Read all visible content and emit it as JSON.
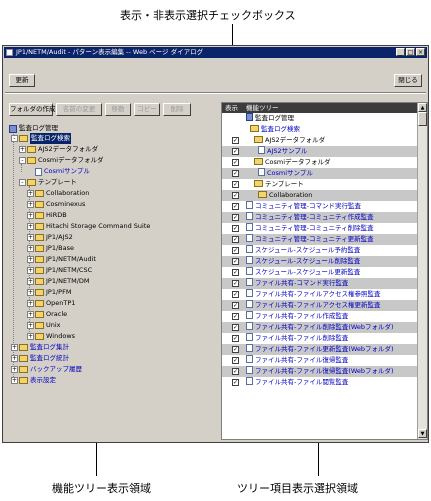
{
  "callouts": {
    "checkbox": "表示・非表示選択チェックボックス",
    "left_area": "機能ツリー表示領域",
    "right_area": "ツリー項目表示選択領域"
  },
  "window": {
    "title": "JP1/NETM/Audit - パターン表示編集 -- Web ページ ダイアログ",
    "min": "_",
    "max": "□",
    "close": "×"
  },
  "toolbar": {
    "update": "更新",
    "close": "閉じる"
  },
  "left_buttons": {
    "create_folder": "フォルダの作成",
    "rename": "名前の変更",
    "move": "移動",
    "copy": "コピー",
    "delete": "削除"
  },
  "tree": [
    {
      "label": "監査ログ管理"
    },
    {
      "label": "監査ログ検索"
    },
    {
      "label": "AJS2データフォルダ"
    },
    {
      "label": "Cosmiデータフォルダ"
    },
    {
      "label": "Cosmiサンプル"
    },
    {
      "label": "テンプレート"
    },
    {
      "label": "Collaboration"
    },
    {
      "label": "Cosminexus"
    },
    {
      "label": "HiRDB"
    },
    {
      "label": "Hitachi Storage Command Suite"
    },
    {
      "label": "JP1/AJS2"
    },
    {
      "label": "JP1/Base"
    },
    {
      "label": "JP1/NETM/Audit"
    },
    {
      "label": "JP1/NETM/CSC"
    },
    {
      "label": "JP1/NETM/DM"
    },
    {
      "label": "JP1/PFM"
    },
    {
      "label": "OpenTP1"
    },
    {
      "label": "Oracle"
    },
    {
      "label": "Unix"
    },
    {
      "label": "Windows"
    },
    {
      "label": "監査ログ集計"
    },
    {
      "label": "監査ログ統計"
    },
    {
      "label": "バックアップ履歴"
    },
    {
      "label": "表示設定"
    }
  ],
  "right_header": {
    "display": "表示",
    "function_tree": "機能ツリー"
  },
  "right_rows": [
    {
      "label": "監査ログ管理",
      "checked": false
    },
    {
      "label": "監査ログ検索",
      "checked": false
    },
    {
      "label": "AJS2データフォルダ",
      "checked": true
    },
    {
      "label": "AJS2サンプル",
      "checked": true
    },
    {
      "label": "Cosmiデータフォルダ",
      "checked": true
    },
    {
      "label": "Cosmiサンプル",
      "checked": true
    },
    {
      "label": "テンプレート",
      "checked": true
    },
    {
      "label": "Collaboration",
      "checked": true
    },
    {
      "label": "コミュニティ管理-コマンド実行監査",
      "checked": true
    },
    {
      "label": "コミュニティ管理-コミュニティ作成監査",
      "checked": true
    },
    {
      "label": "コミュニティ管理-コミュニティ削除監査",
      "checked": true
    },
    {
      "label": "コミュニティ管理-コミュニティ更新監査",
      "checked": true
    },
    {
      "label": "スケジュール-スケジュール予約監査",
      "checked": true
    },
    {
      "label": "スケジュール-スケジュール削除監査",
      "checked": true
    },
    {
      "label": "スケジュール-スケジュール更新監査",
      "checked": true
    },
    {
      "label": "ファイル共有-コマンド実行監査",
      "checked": true
    },
    {
      "label": "ファイル共有-ファイルアクセス権参照監査",
      "checked": true
    },
    {
      "label": "ファイル共有-ファイルアクセス権更新監査",
      "checked": true
    },
    {
      "label": "ファイル共有-ファイル作成監査",
      "checked": true
    },
    {
      "label": "ファイル共有-ファイル削除監査(Webフォルダ)",
      "checked": true
    },
    {
      "label": "ファイル共有-ファイル削除監査",
      "checked": true
    },
    {
      "label": "ファイル共有-ファイル更新監査(Webフォルダ)",
      "checked": true
    },
    {
      "label": "ファイル共有-ファイル復帰監査",
      "checked": true
    },
    {
      "label": "ファイル共有-ファイル復帰監査(Webフォルダ)",
      "checked": true
    },
    {
      "label": "ファイル共有-ファイル閲覧監査",
      "checked": true
    }
  ],
  "icons": {
    "folder": "folder-icon",
    "document": "document-icon",
    "root": "root-icon",
    "expand": "expand-icon",
    "checkbox": "checkbox-icon"
  },
  "colors": {
    "titlebar": "#0a246a",
    "selection": "#0a246a",
    "link": "#0000c0",
    "header": "#3c3c3c",
    "row_shade": "#c8c8c8"
  }
}
